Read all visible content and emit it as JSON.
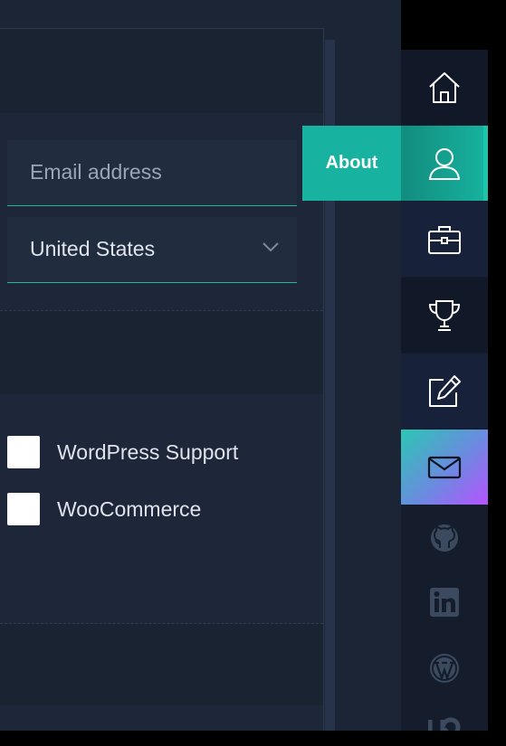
{
  "form": {
    "email_placeholder": "Email address",
    "country_value": "United States"
  },
  "services": [
    {
      "label": "WordPress Support",
      "checked": false
    },
    {
      "label": "WooCommerce",
      "checked": false
    }
  ],
  "nav": {
    "active_tooltip": "About",
    "items": [
      {
        "icon": "home-icon"
      },
      {
        "icon": "user-icon",
        "active": true
      },
      {
        "icon": "briefcase-icon"
      },
      {
        "icon": "trophy-icon"
      },
      {
        "icon": "edit-icon"
      },
      {
        "icon": "mail-icon"
      }
    ],
    "social": [
      "github-icon",
      "linkedin-icon",
      "wordpress-icon",
      "upwork-icon"
    ]
  },
  "colors": {
    "accent": "#17b3a0",
    "background": "#1b2536",
    "contact_gradient_end": "#b653ff"
  }
}
